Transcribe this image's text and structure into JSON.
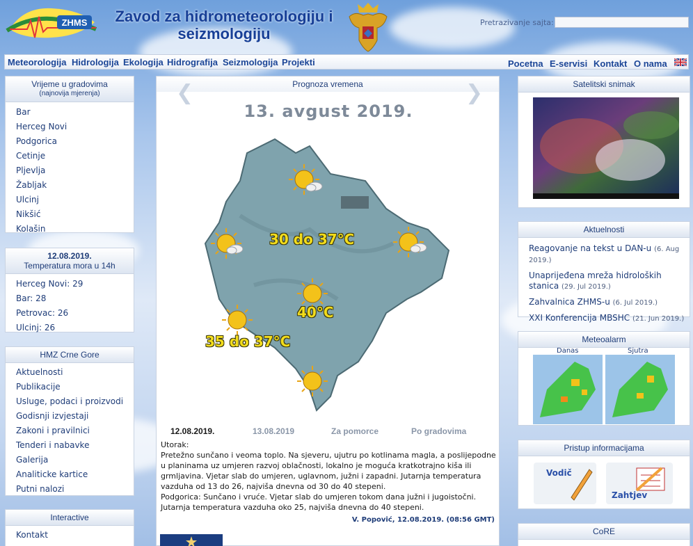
{
  "header": {
    "logo_text": "ZHMS",
    "title_line1": "Zavod za hidrometeorologiju i",
    "title_line2": "seizmologiju",
    "search_label": "Pretrazivanje sajta:",
    "search_value": ""
  },
  "nav": {
    "left": [
      "Meteorologija",
      "Hidrologija",
      "Ekologija",
      "Hidrografija",
      "Seizmologija",
      "Projekti"
    ],
    "right": [
      "Pocetna",
      "E-servisi",
      "Kontakt",
      "O nama"
    ]
  },
  "weather_cities": {
    "title": "Vrijeme u gradovima",
    "subtitle": "(najnovija mjerenja)",
    "items": [
      "Bar",
      "Herceg Novi",
      "Podgorica",
      "Cetinje",
      "Pljevlja",
      "Žabljak",
      "Ulcinj",
      "Nikšić",
      "Kolašin"
    ]
  },
  "sea_temp": {
    "title": "12.08.2019.",
    "subtitle": "Temperatura mora u 14h",
    "items": [
      "Herceg Novi: 29",
      "Bar: 28",
      "Petrovac: 26",
      "Ulcinj: 26"
    ]
  },
  "hmz": {
    "title": "HMZ Crne Gore",
    "items": [
      "Aktuelnosti",
      "Publikacije",
      "Usluge, podaci i proizvodi",
      "Godisnji izvjestaji",
      "Zakoni i pravilnici",
      "Tenderi i nabavke",
      "Galerija",
      "Analiticke kartice",
      "Putni nalozi"
    ]
  },
  "interactive": {
    "title": "Interactive",
    "items": [
      "Kontakt"
    ]
  },
  "forecast": {
    "title": "Prognoza vremena",
    "date": "13. avgust 2019.",
    "temps": [
      "30 do 37°C",
      "40°C",
      "35 do 37°C"
    ],
    "tabs": [
      "12.08.2019.",
      "13.08.2019",
      "Za pomorce",
      "Po gradovima"
    ],
    "text": [
      "Utorak:",
      "Pretežno sunčano i veoma toplo. Na sjeveru, ujutru po kotlinama magla, a poslijepodne u planinama uz umjeren razvoj oblačnosti, lokalno je moguća kratkotrajno kiša ili grmljavina. Vjetar slab do umjeren, uglavnom, južni i zapadni. Jutarnja temperatura vazduha od 13 do 26, najviša dnevna od 30 do 40 stepeni.",
      "Podgorica: Sunčano i vruće. Vjetar slab do umjeren tokom dana južni i jugoistočni. Jutarnja temperatura vazduha oko 25, najviša dnevna do 40 stepeni."
    ],
    "author": "V. Popović, 12.08.2019. (08:56 GMT)"
  },
  "satellite": {
    "title": "Satelitski snimak"
  },
  "news": {
    "title": "Aktuelnosti",
    "items": [
      {
        "text": "Reagovanje na tekst u DAN-u",
        "date": "(6. Aug 2019.)"
      },
      {
        "text": "Unaprijeđena mreža hidroloških stanica",
        "date": "(29. Jul 2019.)"
      },
      {
        "text": "Zahvalnica ZHMS-u",
        "date": "(6. Jul 2019.)"
      },
      {
        "text": "XXI Konferencija MBSHC",
        "date": "(21. Jun 2019.)"
      }
    ]
  },
  "meteoalarm": {
    "title": "Meteoalarm",
    "today": "Danas",
    "tomorrow": "Sjutra"
  },
  "access": {
    "title": "Pristup informacijama",
    "guide": "Vodič",
    "request": "Zahtjev"
  },
  "core": {
    "title": "CoRE"
  }
}
